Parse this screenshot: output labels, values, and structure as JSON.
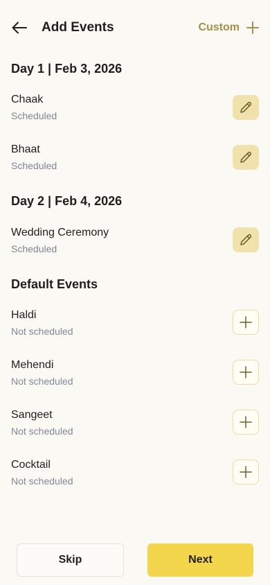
{
  "header": {
    "title": "Add Events",
    "custom_label": "Custom"
  },
  "days": [
    {
      "heading": "Day 1 | Feb 3, 2026",
      "events": [
        {
          "name": "Chaak",
          "status": "Scheduled"
        },
        {
          "name": "Bhaat",
          "status": "Scheduled"
        }
      ]
    },
    {
      "heading": "Day 2 | Feb 4, 2026",
      "events": [
        {
          "name": "Wedding Ceremony",
          "status": "Scheduled"
        }
      ]
    }
  ],
  "defaults": {
    "heading": "Default Events",
    "events": [
      {
        "name": "Haldi",
        "status": "Not scheduled"
      },
      {
        "name": "Mehendi",
        "status": "Not scheduled"
      },
      {
        "name": "Sangeet",
        "status": "Not scheduled"
      },
      {
        "name": "Cocktail",
        "status": "Not scheduled"
      }
    ]
  },
  "footer": {
    "skip_label": "Skip",
    "next_label": "Next"
  },
  "colors": {
    "accent": "#A38F46",
    "primary_button": "#F4D64C",
    "edit_bg": "#EFE2AA",
    "muted_text": "#7E8794",
    "background": "#FBF9F4"
  },
  "icons": {
    "back": "arrow-left-icon",
    "custom": "plus-icon",
    "edit": "pencil-icon",
    "add": "plus-icon"
  }
}
